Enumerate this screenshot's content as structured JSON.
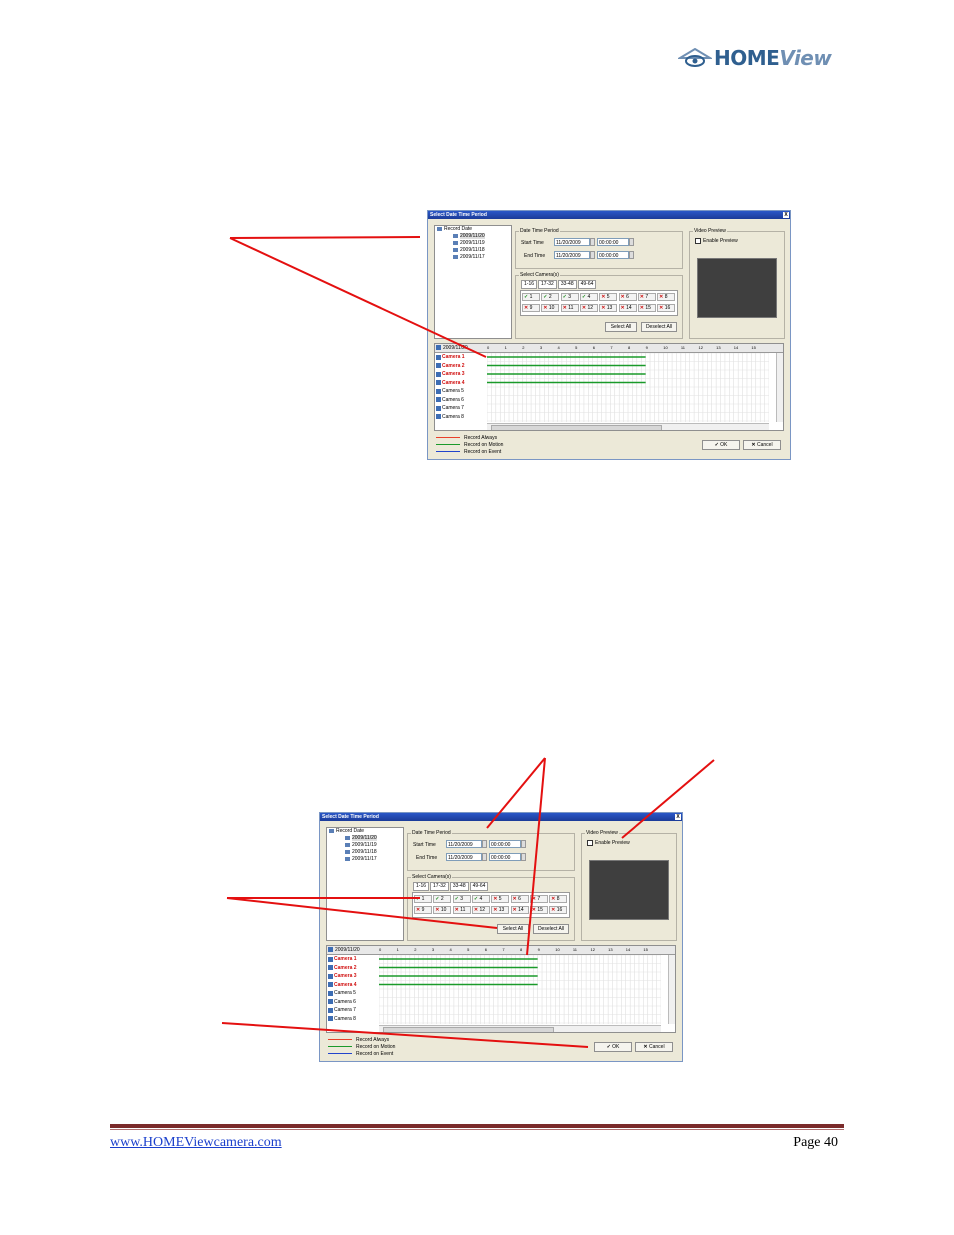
{
  "header": {
    "logo_home": "HOME",
    "logo_view": "View"
  },
  "dialog": {
    "title": "Select Date Time Period",
    "close": "X",
    "tree": {
      "root": "Record Date",
      "dates": [
        "2009/11/20",
        "2009/11/19",
        "2009/11/18",
        "2009/11/17"
      ]
    },
    "date_time_period": {
      "group_label": "Date Time Period",
      "start_label": "Start Time",
      "start_date": "11/20/2009",
      "start_time": "00:00:00",
      "end_label": "End Time",
      "end_date": "11/20/2009",
      "end_time": "00:00:00"
    },
    "select_cameras": {
      "group_label": "Select Camera(s)",
      "tabs": [
        "1-16",
        "17-32",
        "33-48",
        "49-64"
      ],
      "cameras": [
        {
          "num": "1",
          "on": true
        },
        {
          "num": "2",
          "on": true
        },
        {
          "num": "3",
          "on": true
        },
        {
          "num": "4",
          "on": true
        },
        {
          "num": "5",
          "on": false
        },
        {
          "num": "6",
          "on": false
        },
        {
          "num": "7",
          "on": false
        },
        {
          "num": "8",
          "on": false
        },
        {
          "num": "9",
          "on": false
        },
        {
          "num": "10",
          "on": false
        },
        {
          "num": "11",
          "on": false
        },
        {
          "num": "12",
          "on": false
        },
        {
          "num": "13",
          "on": false
        },
        {
          "num": "14",
          "on": false
        },
        {
          "num": "15",
          "on": false
        },
        {
          "num": "16",
          "on": false
        }
      ],
      "select_all": "Select All",
      "deselect_all": "Deselect All"
    },
    "video_preview": {
      "group_label": "Video Preview",
      "enable_label": "Enable Preview"
    },
    "timeline": {
      "date": "2009/11/20",
      "hours": [
        "0",
        "1",
        "2",
        "3",
        "4",
        "5",
        "6",
        "7",
        "8",
        "9",
        "10",
        "11",
        "12",
        "13",
        "14",
        "15"
      ],
      "cameras": [
        {
          "name": "Camera 1",
          "recorded": true
        },
        {
          "name": "Camera 2",
          "recorded": true
        },
        {
          "name": "Camera 3",
          "recorded": true
        },
        {
          "name": "Camera 4",
          "recorded": true
        },
        {
          "name": "Camera 5",
          "recorded": false
        },
        {
          "name": "Camera 6",
          "recorded": false
        },
        {
          "name": "Camera 7",
          "recorded": false
        },
        {
          "name": "Camera 8",
          "recorded": false
        }
      ],
      "record_end_hour": 9
    },
    "legend": {
      "always": "Record Always",
      "motion": "Record on Motion",
      "event": "Record on Event",
      "always_color": "#e8402a",
      "motion_color": "#1a9a2a",
      "event_color": "#2244cc"
    },
    "ok": "OK",
    "cancel": "Cancel"
  },
  "footer": {
    "url": "www.HOMEViewcamera.com",
    "page": "Page 40"
  }
}
